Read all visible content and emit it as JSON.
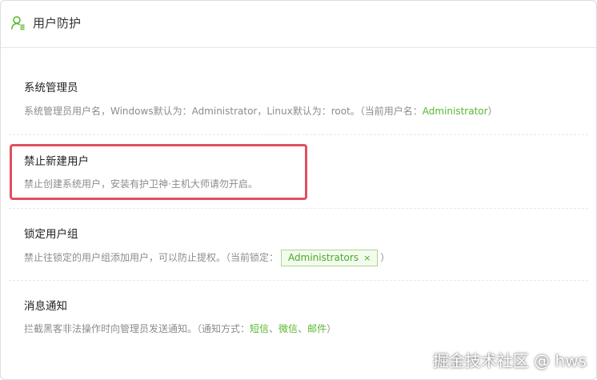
{
  "header": {
    "icon": "user-shield-icon",
    "title": "用户防护"
  },
  "sections": [
    {
      "title": "系统管理员",
      "desc_prefix": "系统管理员用户名，Windows默认为：Administrator，Linux默认为：root。（当前用户名：",
      "current_user": "Administrator",
      "desc_suffix": "）"
    },
    {
      "title": "禁止新建用户",
      "desc": "禁止创建系统用户，安装有护卫神·主机大师请勿开启。"
    },
    {
      "title": "锁定用户组",
      "desc_prefix": "禁止往锁定的用户组添加用户，可以防止提权。（当前锁定：",
      "tag": "Administrators",
      "tag_close": "×",
      "desc_suffix": "）"
    },
    {
      "title": "消息通知",
      "desc_prefix": "拦截黑客非法操作时向管理员发送通知。（通知方式：",
      "methods": [
        "短信",
        "微信",
        "邮件"
      ],
      "sep": "、",
      "desc_suffix": "）"
    }
  ],
  "watermark": "掘金技术社区 @ hws",
  "colors": {
    "accent_green": "#5ab82e",
    "highlight_red": "#e0505f"
  }
}
